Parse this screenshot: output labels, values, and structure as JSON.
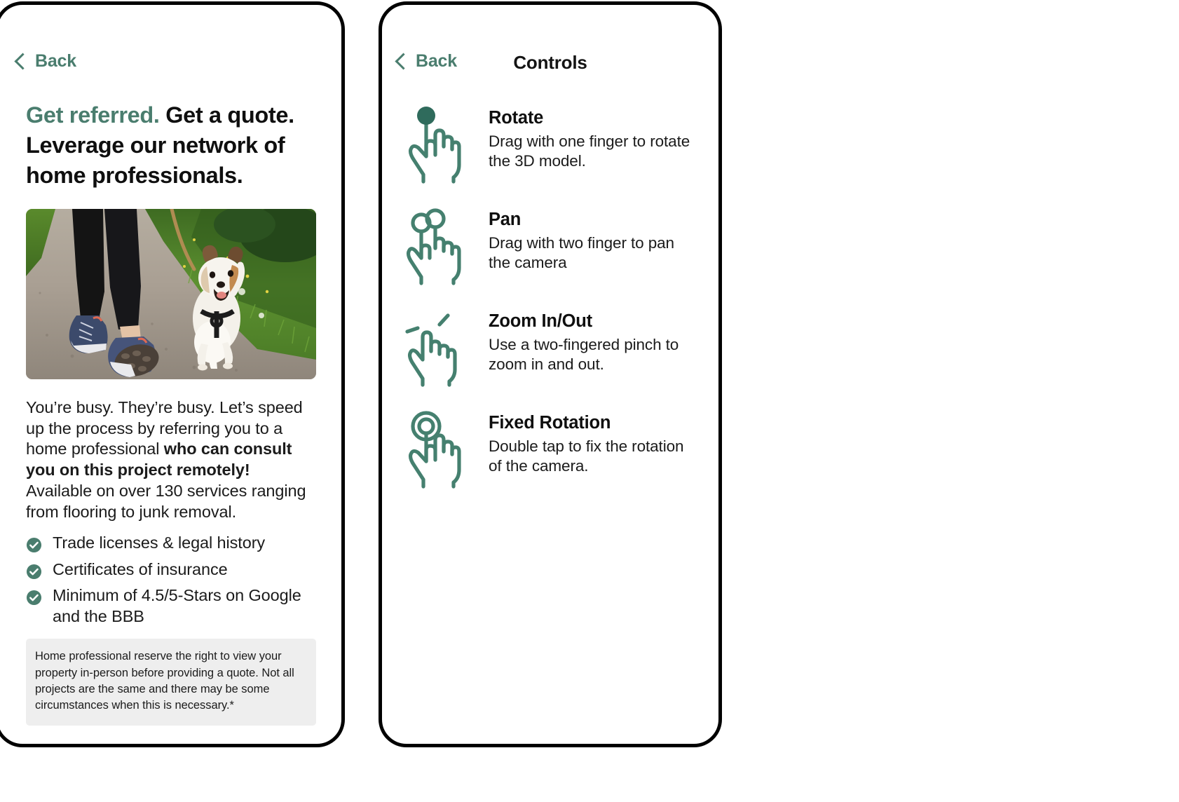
{
  "colors": {
    "accent_green": "#4a7d6e",
    "text_dark": "#1b1b1b",
    "frame_black": "#000000",
    "disclaimer_bg": "#eeeeee"
  },
  "left_panel": {
    "nav": {
      "back_label": "Back",
      "back_icon": "chevron-left-icon"
    },
    "headline": {
      "accent_part": "Get referred.",
      "rest_part": " Get a quote. Leverage our network of home professionals."
    },
    "hero_image": {
      "alt": "Person walking a Jack Russell terrier on a gravel path beside green grass"
    },
    "paragraph": {
      "part1": "You’re busy. They’re busy. Let’s speed up the process by referring you to a home professional ",
      "bold": "who can consult you on this project remotely!",
      "part2": " Available on over 130 services ranging from flooring to junk removal."
    },
    "checklist": [
      "Trade licenses & legal history",
      "Certificates of insurance",
      "Minimum of 4.5/5-Stars on Google and the BBB"
    ],
    "disclaimer": "Home professional reserve the right to view your property in-person before providing a quote. Not all projects are the same and there may be some circumstances when this is necessary.*"
  },
  "right_panel": {
    "nav": {
      "back_label": "Back",
      "back_icon": "chevron-left-icon",
      "title": "Controls"
    },
    "controls": [
      {
        "icon": "hand-one-finger-tap-icon",
        "title": "Rotate",
        "description": "Drag with one finger to rotate the 3D model."
      },
      {
        "icon": "hand-two-finger-drag-icon",
        "title": "Pan",
        "description": "Drag with two finger to pan the camera"
      },
      {
        "icon": "hand-pinch-zoom-icon",
        "title": "Zoom In/Out",
        "description": "Use a two-fingered pinch to zoom in and out."
      },
      {
        "icon": "hand-double-tap-icon",
        "title": "Fixed Rotation",
        "description": "Double tap to fix the rotation of the camera."
      }
    ]
  }
}
